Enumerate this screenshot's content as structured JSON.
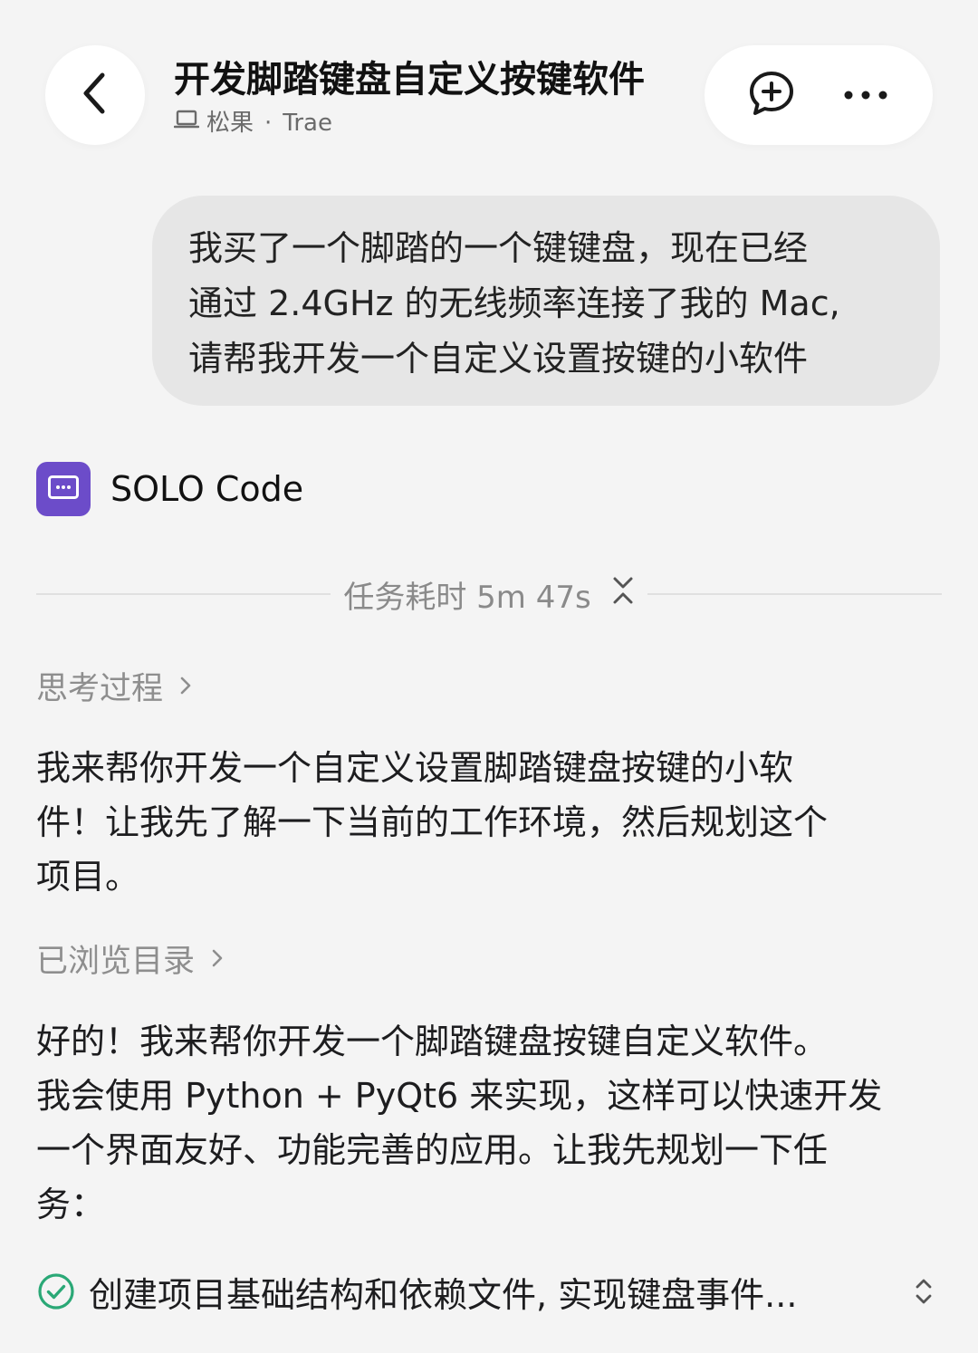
{
  "header": {
    "title": "开发脚踏键盘自定义按键软件",
    "device": "松果",
    "separator": "·",
    "app": "Trae"
  },
  "user_message": {
    "lines": [
      "我买了一个脚踏的一个键键盘，现在已经",
      "通过 2.4GHz 的无线频率连接了我的 Mac,",
      "请帮我开发一个自定义设置按键的小软件"
    ]
  },
  "agent": {
    "name": "SOLO Code",
    "avatar_color": "#6c4cc9"
  },
  "task_duration": "任务耗时 5m 47s",
  "thinking_label": "思考过程",
  "reply1": {
    "lines": [
      "我来帮你开发一个自定义设置脚踏键盘按键的小软",
      "件！让我先了解一下当前的工作环境，然后规划这个",
      "项目。"
    ]
  },
  "browsed_label": "已浏览目录",
  "reply2": {
    "lines": [
      "好的！我来帮你开发一个脚踏键盘按键自定义软件。",
      "我会使用 Python + PyQt6 来实现，这样可以快速开发",
      "一个界面友好、功能完善的应用。让我先规划一下任",
      "务："
    ]
  },
  "task": {
    "text": "创建项目基础结构和依赖文件, 实现键盘事件...",
    "check_color": "#2aa876"
  },
  "icons": {
    "back": "chevron-left-icon",
    "new_chat": "add-comment-icon",
    "more": "more-horizontal-icon",
    "device": "laptop-icon",
    "duration_toggle": "collapse-icon",
    "expand": "chevron-right-icon",
    "task_status": "check-circle-icon",
    "task_toggle": "expand-vertical-icon"
  }
}
